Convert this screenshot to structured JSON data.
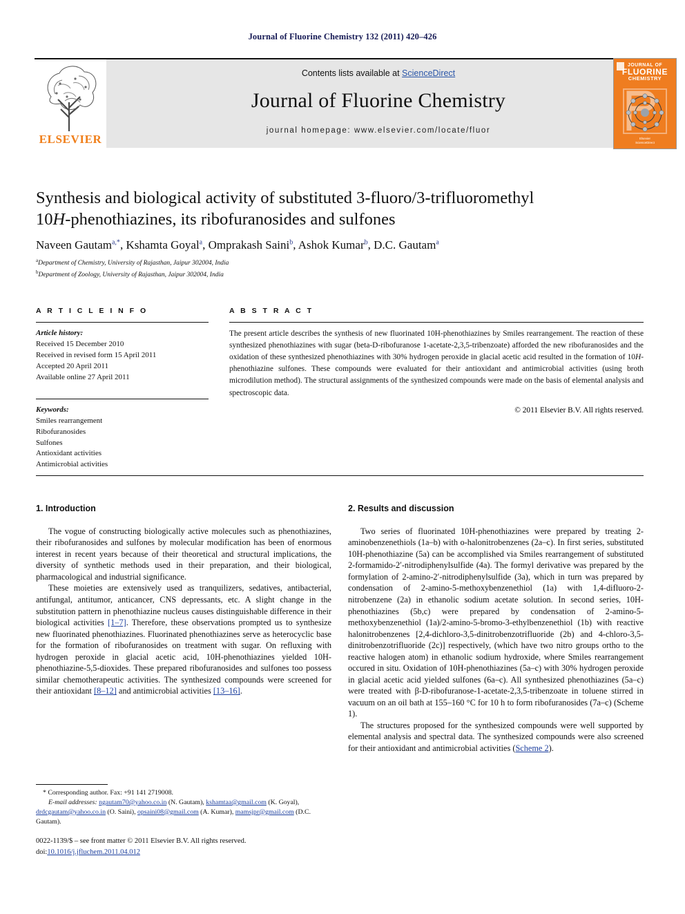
{
  "running_head": "Journal of Fluorine Chemistry 132 (2011) 420–426",
  "masthead": {
    "contents_prefix": "Contents lists available at ",
    "sciencedirect": "ScienceDirect",
    "journal_name": "Journal of Fluorine Chemistry",
    "homepage": "journal homepage: www.elsevier.com/locate/fluor",
    "publisher_logo_text": "ELSEVIER",
    "cover": {
      "line1": "JOURNAL OF",
      "line2": "FLUORINE",
      "line3": "CHEMISTRY",
      "footer_line1": "Elsevier",
      "footer_line2": "ScienceDirect"
    },
    "accent_orange": "#ef7d20",
    "link_blue": "#2b56a8"
  },
  "article": {
    "title_line1": "Synthesis and biological activity of substituted 3-fluoro/3-trifluoromethyl",
    "title_line2_pre": "10",
    "title_line2_ital": "H",
    "title_line2_post": "-phenothiazines, its ribofuranosides and sulfones",
    "authors": [
      {
        "name": "Naveen Gautam",
        "marks": "a,*"
      },
      {
        "name": "Kshamta Goyal",
        "marks": "a"
      },
      {
        "name": "Omprakash Saini",
        "marks": "b"
      },
      {
        "name": "Ashok Kumar",
        "marks": "b"
      },
      {
        "name": "D.C. Gautam",
        "marks": "a"
      }
    ],
    "affiliations": [
      {
        "mark": "a",
        "text": "Department of Chemistry, University of Rajasthan, Jaipur 302004, India"
      },
      {
        "mark": "b",
        "text": "Department of Zoology, University of Rajasthan, Jaipur 302004, India"
      }
    ]
  },
  "info": {
    "heading": "A R T I C L E   I N F O",
    "history_label": "Article history:",
    "history": [
      "Received 15 December 2010",
      "Received in revised form 15 April 2011",
      "Accepted 20 April 2011",
      "Available online 27 April 2011"
    ],
    "keywords_label": "Keywords:",
    "keywords": [
      "Smiles rearrangement",
      "Ribofuranosides",
      "Sulfones",
      "Antioxidant activities",
      "Antimicrobial activities"
    ]
  },
  "abstract": {
    "heading": "A B S T R A C T",
    "body_part1": "The present article describes the synthesis of new fluorinated 10H-phenothiazines by Smiles rearrangement. The reaction of these synthesized phenothiazines with sugar (beta-",
    "body_smallcaps1": "D",
    "body_part2": "-ribofuranose 1-acetate-2,3,5-tribenzoate) afforded the new ribofuranosides and the oxidation of these synthesized phenothiazines with 30% hydrogen peroxide in glacial acetic acid resulted in the formation of 10",
    "body_ital1": "H",
    "body_part3": "-phenothiazine sulfones. These compounds were evaluated for their antioxidant and antimicrobial activities (using broth microdilution method). The structural assignments of the synthesized compounds were made on the basis of elemental analysis and spectroscopic data.",
    "copyright": "© 2011 Elsevier B.V. All rights reserved."
  },
  "sections": {
    "introduction": {
      "heading": "1. Introduction",
      "p1": "The vogue of constructing biologically active molecules such as phenothiazines, their ribofuranosides and sulfones by molecular modification has been of enormous interest in recent years because of their theoretical and structural implications, the diversity of synthetic methods used in their preparation, and their biological, pharmacological and industrial significance.",
      "p2_a": "These moieties are extensively used as tranquilizers, sedatives, antibacterial, antifungal, antitumor, anticancer, CNS depressants, etc. A slight change in the substitution pattern in phenothiazine nucleus causes distinguishable difference in their biological activities ",
      "p2_ref1": "[1–7]",
      "p2_b": ". Therefore, these observations prompted us to synthesize new fluorinated phenothiazines. Fluorinated phenothiazines serve as heterocyclic base for the formation of ribofuranosides on treatment with sugar. On refluxing with hydrogen peroxide in glacial acetic acid, 10H-phenothiazines yielded 10H-phenothiazine-5,5-dioxides. These prepared ribofuranosides and sulfones too possess similar chemotherapeutic activities. The synthesized compounds were screened for their antioxidant ",
      "p2_ref2": "[8–12]",
      "p2_c": " and antimicrobial activities ",
      "p2_ref3": "[13–16]",
      "p2_d": "."
    },
    "results": {
      "heading": "2. Results and discussion",
      "p1": "Two series of fluorinated 10H-phenothiazines were prepared by treating 2-aminobenzenethiols (1a–b) with o-halonitrobenzenes (2a–c). In first series, substituted 10H-phenothiazine (5a) can be accomplished via Smiles rearrangement of substituted 2-formamido-2′-nitrodiphenylsulfide (4a). The formyl derivative was prepared by the formylation of 2-amino-2′-nitrodiphenylsulfide (3a), which in turn was prepared by condensation of 2-amino-5-methoxybenzenethiol (1a) with 1,4-difluoro-2-nitrobenzene (2a) in ethanolic sodium acetate solution. In second series, 10H-phenothiazines (5b,c) were prepared by condensation of 2-amino-5-methoxybenzenethiol (1a)/2-amino-5-bromo-3-ethylbenzenethiol (1b) with reactive halonitrobenzenes [2,4-dichloro-3,5-dinitrobenzotrifluoride (2b) and 4-chloro-3,5-dinitrobenzotrifluoride (2c)] respectively, (which have two nitro groups ortho to the reactive halogen atom) in ethanolic sodium hydroxide, where Smiles rearrangement occured in situ. Oxidation of 10H-phenothiazines (5a–c) with 30% hydrogen peroxide in glacial acetic acid yielded sulfones (6a–c). All synthesized phenothiazines (5a–c) were treated with β-D-ribofuranose-1-acetate-2,3,5-tribenzoate in toluene stirred in vacuum on an oil bath at 155–160 °C for 10 h to form ribofuranosides (7a–c) (Scheme 1).",
      "p1_link": "Scheme 1",
      "p2_a": "The structures proposed for the synthesized compounds were well supported by elemental analysis and spectral data. The synthesized compounds were also screened for their antioxidant and antimicrobial activities (",
      "p2_link": "Scheme 2",
      "p2_b": ")."
    }
  },
  "footnote": {
    "corresponding": "* Corresponding author. Fax: +91 141 2719008.",
    "email_label": "E-mail addresses:",
    "emails": [
      {
        "address": "ngautam70@yahoo.co.in",
        "person": " (N. Gautam), "
      },
      {
        "address": "kshamtaa@gmail.com",
        "person": " (K. Goyal), "
      },
      {
        "address": "drdcgautam@yahoo.co.in",
        "person": " (O. Saini), "
      },
      {
        "address": "opsaini08@gmail.com",
        "person": " (A. Kumar), "
      },
      {
        "address": "mamsjpr@gmail.com",
        "person": " (D.C. Gautam)."
      }
    ]
  },
  "footer": {
    "issn_line": "0022-1139/$ – see front matter © 2011 Elsevier B.V. All rights reserved.",
    "doi_label": "doi:",
    "doi_value": "10.1016/j.jfluchem.2011.04.012"
  }
}
